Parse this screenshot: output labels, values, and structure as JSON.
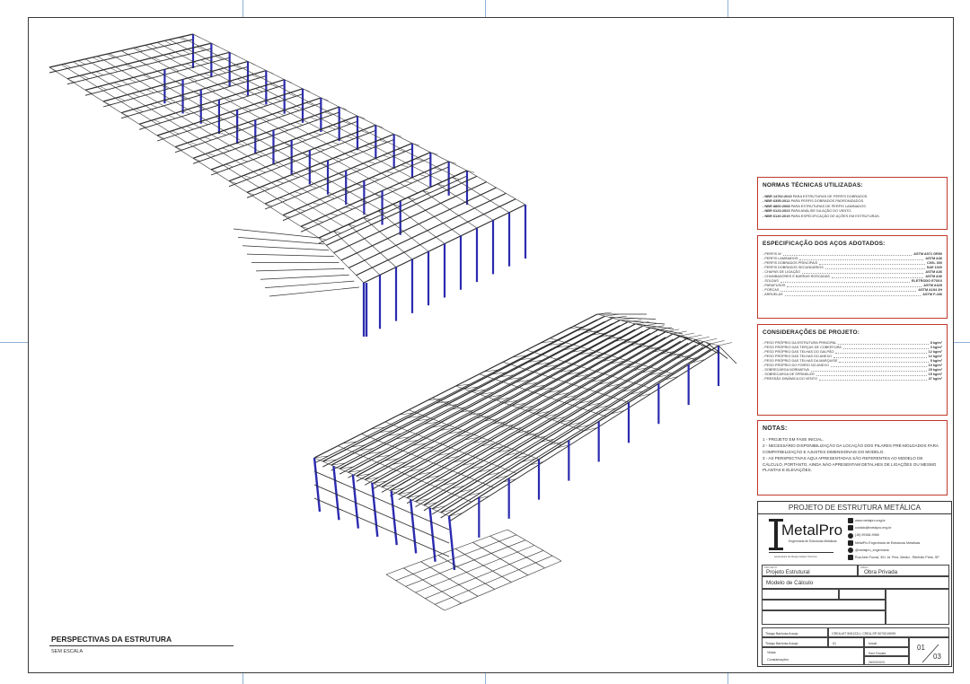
{
  "normas": {
    "title": "NORMAS TÉCNICAS UTILIZADAS:",
    "items": [
      {
        "code": "- NBR 14762:2010",
        "text": "PARA ESTRUTURAS DE PERFIS DOBRADOS."
      },
      {
        "code": "- NBR 6355:2012",
        "text": "PARA PERFIS DOBRADOS PADRONIZADOS."
      },
      {
        "code": "- NBR 8800:2008",
        "text": "PARA ESTRUTURAS DE PERFIS LAMINADOS."
      },
      {
        "code": "- NBR 6123:2023",
        "text": "PARA ANÁLISE DA AÇÃO DO VENTO."
      },
      {
        "code": "- NBR 6120:2019",
        "text": "PARA ESPECIFICAÇÃO DE AÇÕES EM ESTRUTURAS."
      }
    ]
  },
  "acos": {
    "title": "ESPECIFICAÇÃO DOS AÇOS ADOTADOS:",
    "items": [
      {
        "label": "- PERFIS W",
        "value": "ASTM A572 GR50"
      },
      {
        "label": "- PERFIS LAMINADOS",
        "value": "ASTM A36"
      },
      {
        "label": "- PERFIS DOBRADOS PRINCIPAIS",
        "value": "CIVIL 300"
      },
      {
        "label": "- PERFIS DOBRADOS SECUNDÁRIOS",
        "value": "SAE 1020"
      },
      {
        "label": "- CHAPAS DE LIGAÇÃO",
        "value": "ASTM A36"
      },
      {
        "label": "- CHUMBADORES E BARRAS ROSCADAS",
        "value": "ASTM A36"
      },
      {
        "label": "- SOLDAS",
        "value": "ELETRODO E70XX"
      },
      {
        "label": "- PARAFUSOS",
        "value": "ASTM A325"
      },
      {
        "label": "- PORCAS",
        "value": "ASTM A194 2H"
      },
      {
        "label": "- ARRUELAS",
        "value": "ASTM F-436"
      }
    ]
  },
  "consideracoes": {
    "title": "CONSIDERAÇÕES DE PROJETO:",
    "items": [
      {
        "label": "- PESO PRÓPRIO DA ESTRUTURA PRINCIPAL",
        "value": "8 kg/m²"
      },
      {
        "label": "- PESO PRÓPRIO DAS TERÇAS DE COBERTURA",
        "value": "3 kg/m²"
      },
      {
        "label": "- PESO PRÓPRIO DAS TELHAS DO GALPÃO",
        "value": "12 kg/m²"
      },
      {
        "label": "- PESO PRÓPRIO DAS TELHAS DO ANEXO",
        "value": "12 kg/m²"
      },
      {
        "label": "- PESO PRÓPRIO DAS TELHAS DA MARQUISE",
        "value": "5 kg/m²"
      },
      {
        "label": "- PESO PRÓPRIO DO FORRO NO ANEXO",
        "value": "10 kg/m²"
      },
      {
        "label": "- SOBRECARGA NORMATIVA",
        "value": "25 kg/m²"
      },
      {
        "label": "- SOBRECARGA DE SPRINKLER",
        "value": "15 kg/m²"
      },
      {
        "label": "- PRESSÃO DINÂMICA DO VENTO",
        "value": "47 kg/m²"
      }
    ]
  },
  "notas": {
    "title": "NOTAS:",
    "items": [
      "1 - PROJETO EM FASE INICIAL.",
      "2 - NECESSÁRIO DISPONIBILIZAÇÃO DA LOCAÇÃO DOS PILARES PRÉ-MOLDADOS PARA COMPATIBILIZAÇÃO E AJUSTES DIMENSIONAIS DO MODELO.",
      "3 - AS PERSPECTIVAS AQUI APRESENTADAS SÃO REFERENTES AO MODELO DE CÁLCULO, PORTANTO, AINDA NÃO APRESENTAM DETALHES DE LIGAÇÕES OU MESMO PLANTAS E ELEVAÇÕES."
    ]
  },
  "title_block": {
    "header": "PROJETO DE ESTRUTURA METÁLICA",
    "logo_name": "MetalPro",
    "logo_sub": "Engenharia de Estruturas Metálicas",
    "logo_sign": "Assinatura do Responsável Técnico",
    "contacts": [
      "www.metalpro.eng.br",
      "contato@metalpro.eng.br",
      "(16) 99168-9968",
      "MetalPro Engenharia de Estruturas Metálicas",
      "@metalpro_engenharia",
      "Rua Aldo Focosi, 301 Jd. Pres. Médici - Ribeirão Preto, SP"
    ],
    "projeto": "Projeto Estrutural",
    "obra": "Obra Privada",
    "modelo": "Modelo de Cálculo",
    "responsavel1": "Thiago Barbosa Araujo",
    "crea": "CREA-MT 5061231 | CREA-SP 5070019099",
    "responsavel2": "Thiago Barbosa Araujo",
    "revisao": "01",
    "fase": "Inicial",
    "conteudo1": "Vistas",
    "conteudo2": "Considerações",
    "escala": "Sem Escala",
    "data": "26/03/2023",
    "folha": "01",
    "total": "03"
  },
  "perspectivas": {
    "title": "PERSPECTIVAS DA ESTRUTURA",
    "scale": "SEM ESCALA"
  }
}
